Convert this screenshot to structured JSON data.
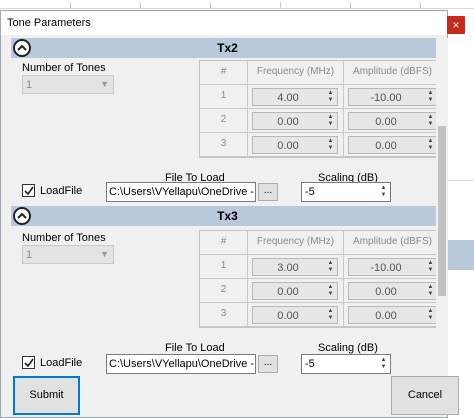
{
  "window": {
    "title": "Tone Parameters",
    "close": "×"
  },
  "sections": [
    {
      "title": "Tx2",
      "num_tones_label": "Number of Tones",
      "num_tones_value": "1",
      "grid_headers": [
        "#",
        "Frequency (MHz)",
        "Amplitude (dBFS)"
      ],
      "rows": [
        {
          "idx": "1",
          "freq": "4.00",
          "amp": "-10.00"
        },
        {
          "idx": "2",
          "freq": "0.00",
          "amp": "0.00"
        },
        {
          "idx": "3",
          "freq": "0.00",
          "amp": "0.00"
        }
      ],
      "file_label": "File To Load",
      "scaling_label": "Scaling (dB)",
      "loadfile_label": "LoadFile",
      "loadfile_checked": true,
      "file_path": "C:\\Users\\VYellapu\\OneDrive - Ar",
      "browse_label": "...",
      "scaling_value": "-5"
    },
    {
      "title": "Tx3",
      "num_tones_label": "Number of Tones",
      "num_tones_value": "1",
      "grid_headers": [
        "#",
        "Frequency (MHz)",
        "Amplitude (dBFS)"
      ],
      "rows": [
        {
          "idx": "1",
          "freq": "3.00",
          "amp": "-10.00"
        },
        {
          "idx": "2",
          "freq": "0.00",
          "amp": "0.00"
        },
        {
          "idx": "3",
          "freq": "0.00",
          "amp": "0.00"
        }
      ],
      "file_label": "File To Load",
      "scaling_label": "Scaling (dB)",
      "loadfile_label": "LoadFile",
      "loadfile_checked": true,
      "file_path": "C:\\Users\\VYellapu\\OneDrive - Ar",
      "browse_label": "...",
      "scaling_value": "-5"
    }
  ],
  "buttons": {
    "submit": "Submit",
    "cancel": "Cancel"
  },
  "colors": {
    "section_header": "#b9c8da",
    "close_button": "#c42b1c",
    "focus_border": "#0078d7"
  }
}
